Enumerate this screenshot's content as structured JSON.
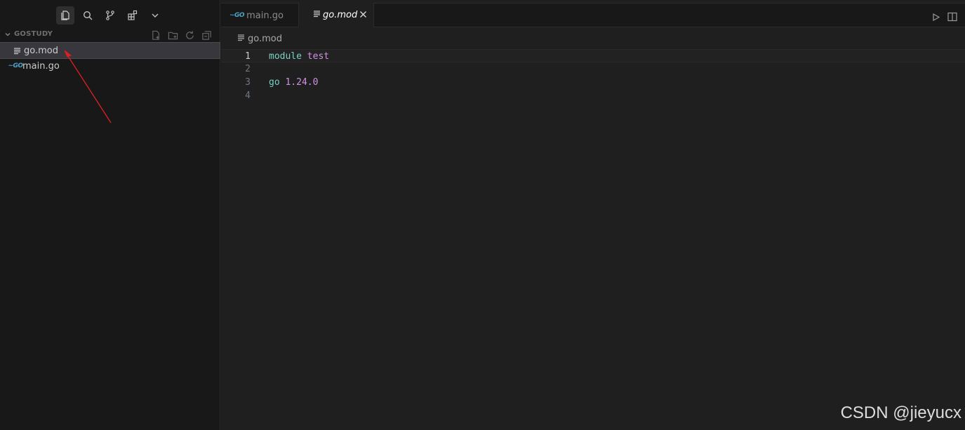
{
  "activity_bar": {
    "items": [
      "explorer-icon",
      "search-icon",
      "source-control-icon",
      "extensions-icon",
      "chevron-down-icon"
    ]
  },
  "explorer": {
    "folder_name": "GOSTUDY",
    "actions": [
      "new-file-icon",
      "new-folder-icon",
      "refresh-icon",
      "collapse-all-icon"
    ],
    "files": [
      {
        "name": "go.mod",
        "icon": "lines-icon",
        "selected": true
      },
      {
        "name": "main.go",
        "icon": "go-icon",
        "selected": false
      }
    ]
  },
  "tabs": [
    {
      "label": "main.go",
      "active": false,
      "icon_text": "GO"
    },
    {
      "label": "go.mod",
      "active": true
    }
  ],
  "editor_actions": [
    "run-icon",
    "split-editor-icon"
  ],
  "breadcrumb": {
    "file": "go.mod"
  },
  "code": {
    "lines": [
      {
        "number": "1",
        "kw": "module",
        "value": "test"
      },
      {
        "number": "2",
        "kw": "",
        "value": ""
      },
      {
        "number": "3",
        "kw": "go",
        "value": "1.24.0"
      },
      {
        "number": "4",
        "kw": "",
        "value": ""
      }
    ]
  },
  "watermark": "CSDN @jieyucx",
  "colors": {
    "background": "#181818",
    "editor_bg": "#1f1f1f",
    "keyword": "#7ad0c2",
    "value": "#d291e4",
    "go_icon": "#4fa3c7",
    "annotation_arrow": "#e02020"
  }
}
